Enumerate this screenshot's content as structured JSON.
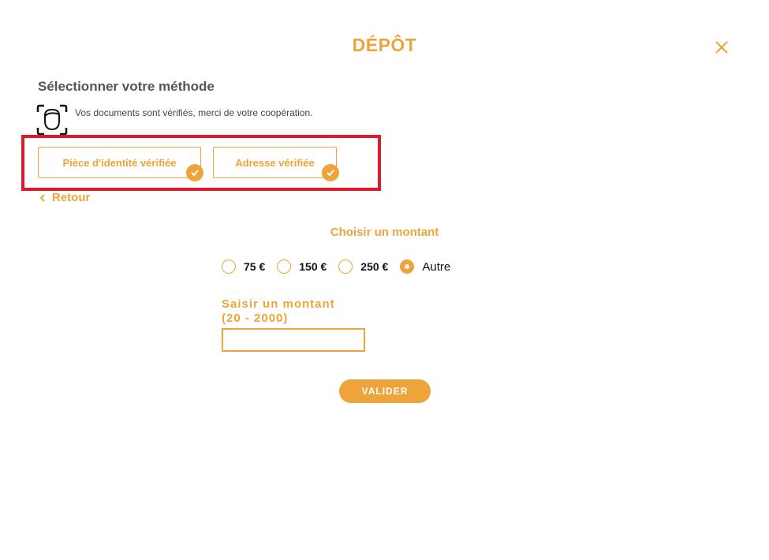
{
  "modal": {
    "title": "DÉPÔT",
    "close_icon": "close-icon"
  },
  "method": {
    "heading": "Sélectionner votre méthode",
    "icon": "face-scan-icon",
    "note": "Vos documents sont vérifiés, merci de votre coopération.",
    "documents": [
      {
        "label": "Pièce d'identité vérifiée",
        "status_icon": "check-icon"
      },
      {
        "label": "Adresse vérifiée",
        "status_icon": "check-icon"
      }
    ],
    "highlight_color": "#e0192a"
  },
  "back": {
    "label": "Retour",
    "icon": "chevron-left-icon"
  },
  "amount": {
    "heading": "Choisir un montant",
    "options": [
      {
        "label": "75 €",
        "selected": false
      },
      {
        "label": "150 €",
        "selected": false
      },
      {
        "label": "250 €",
        "selected": false
      },
      {
        "label": "Autre",
        "selected": true
      }
    ],
    "custom_label_line1": "Saisir un montant",
    "custom_label_line2": "(20 - 2000)",
    "custom_value": "",
    "submit_label": "VALIDER"
  },
  "colors": {
    "accent": "#eea43a",
    "text": "#555555"
  }
}
